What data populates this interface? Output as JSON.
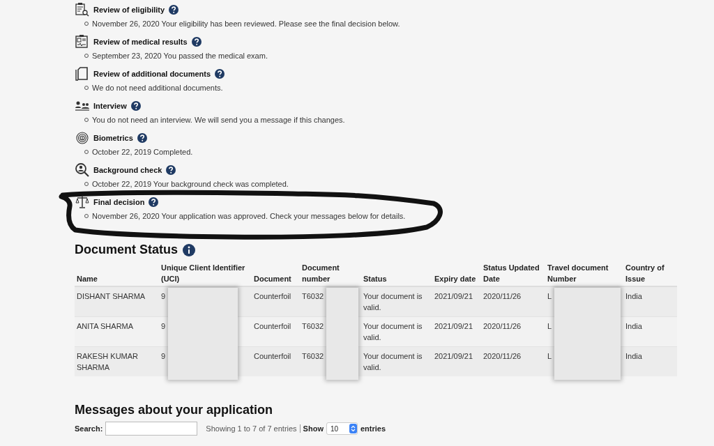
{
  "timeline": [
    {
      "kind": "eligibility",
      "title": "Review of eligibility",
      "detail": "November 26, 2020 Your eligibility has been reviewed. Please see the final decision below."
    },
    {
      "kind": "medical",
      "title": "Review of medical results",
      "detail": "September 23, 2020 You passed the medical exam."
    },
    {
      "kind": "documents",
      "title": "Review of additional documents",
      "detail": "We do not need additional documents."
    },
    {
      "kind": "interview",
      "title": "Interview",
      "detail": "You do not need an interview. We will send you a message if this changes."
    },
    {
      "kind": "biometrics",
      "title": "Biometrics",
      "detail": "October 22, 2019 Completed."
    },
    {
      "kind": "background",
      "title": "Background check",
      "detail": "October 22, 2019 Your background check was completed."
    },
    {
      "kind": "decision",
      "title": "Final decision",
      "detail": "November 26, 2020 Your application was approved. Check your messages below for details."
    }
  ],
  "document_status": {
    "title": "Document Status",
    "columns": [
      {
        "label": "Name",
        "redacted": false
      },
      {
        "label": "Unique Client Identifier (UCI)",
        "redacted": true
      },
      {
        "label": "Document",
        "redacted": false
      },
      {
        "label": "Document number",
        "redacted": true
      },
      {
        "label": "Status",
        "redacted": false
      },
      {
        "label": "Expiry date",
        "redacted": false
      },
      {
        "label": "Status Updated Date",
        "redacted": false
      },
      {
        "label": "Travel document Number",
        "redacted": true
      },
      {
        "label": "Country of Issue",
        "redacted": false
      }
    ],
    "rows": [
      [
        "DISHANT SHARMA",
        "9",
        "Counterfoil",
        "T6032",
        "Your document is valid.",
        "2021/09/21",
        "2020/11/26",
        "L",
        "India"
      ],
      [
        "ANITA SHARMA",
        "9",
        "Counterfoil",
        "T6032",
        "Your document is valid.",
        "2021/09/21",
        "2020/11/26",
        "L",
        "India"
      ],
      [
        "RAKESH KUMAR SHARMA",
        "9",
        "Counterfoil",
        "T6032",
        "Your document is valid.",
        "2021/09/21",
        "2020/11/26",
        "L",
        "India"
      ]
    ]
  },
  "messages": {
    "title": "Messages about your application",
    "search_label": "Search:",
    "info": "Showing 1 to 7 of 7 entries",
    "show_label": "Show",
    "page_size": "10",
    "entries_label": "entries"
  }
}
